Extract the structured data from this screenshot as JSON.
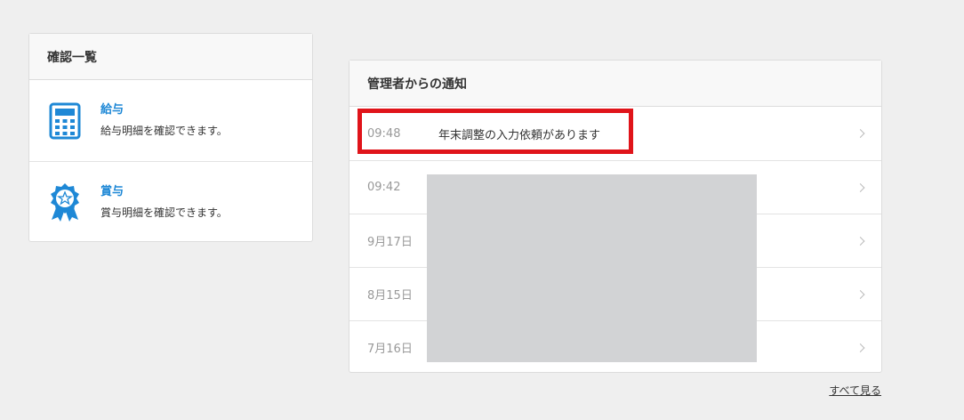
{
  "confirm": {
    "title": "確認一覧",
    "items": [
      {
        "icon": "calculator-icon",
        "title": "給与",
        "desc": "給与明細を確認できます。"
      },
      {
        "icon": "award-ribbon-icon",
        "title": "賞与",
        "desc": "賞与明細を確認できます。"
      }
    ]
  },
  "notices": {
    "title": "管理者からの通知",
    "rows": [
      {
        "date": "09:48",
        "text": "年末調整の入力依頼があります"
      },
      {
        "date": "09:42",
        "text": ""
      },
      {
        "date": "9月17日",
        "text": ""
      },
      {
        "date": "8月15日",
        "text": ""
      },
      {
        "date": "7月16日",
        "text": ""
      }
    ],
    "see_all": "すべて見る"
  },
  "colors": {
    "accent": "#1e88d6",
    "highlight": "#e0141a",
    "redaction": "#d2d3d5"
  }
}
